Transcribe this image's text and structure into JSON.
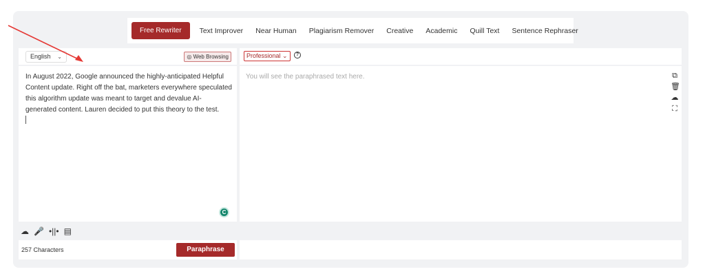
{
  "tabs": [
    {
      "label": "Free Rewriter",
      "active": true
    },
    {
      "label": "Text Improver"
    },
    {
      "label": "Near Human"
    },
    {
      "label": "Plagiarism Remover"
    },
    {
      "label": "Creative"
    },
    {
      "label": "Academic"
    },
    {
      "label": "Quill Text"
    },
    {
      "label": "Sentence Rephraser"
    }
  ],
  "left": {
    "language": "English",
    "web_browsing": "Web Browsing",
    "input_text": "In August 2022, Google announced the highly-anticipated Helpful Content update. Right off the bat, marketers everywhere speculated this algorithm update was meant to target and devalue AI-generated content. Lauren decided to put this theory to the test.",
    "char_count": "257 Characters",
    "paraphrase_label": "Paraphrase"
  },
  "right": {
    "tone": "Professional",
    "placeholder": "You will see the paraphrased text here."
  },
  "colors": {
    "accent": "#a52a2a",
    "background": "#f1f2f4",
    "annotation_arrow": "#e53935"
  },
  "icons": [
    "help-icon",
    "copy-icon",
    "trash-icon",
    "upload-cloud-icon",
    "fullscreen-icon",
    "microphone-icon",
    "audio-wave-icon",
    "image-icon",
    "grammarly-icon"
  ]
}
